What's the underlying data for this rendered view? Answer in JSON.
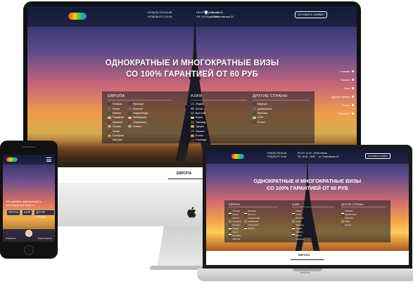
{
  "site": {
    "phones": [
      "+375(29) 370-64-56",
      "+375(29) 677-13-34"
    ],
    "hours": [
      "ПН-ПТ: 10:00 - 19:00",
      "СБ: 10:00 - 16:00"
    ],
    "address": [
      "г. Минск",
      "ул. Ульяновская 31"
    ],
    "cta_label": "ОСТАВИТЬ ЗАЯВКУ",
    "headline_line1": "ОДНОКРАТНЫЕ И МНОГОКРАТНЫЕ ВИЗЫ",
    "headline_line2": "СО 100% ГАРАНТИЕЙ ОТ 60 РУБ",
    "columns": {
      "europe": {
        "title": "ЕВРОПА",
        "left": [
          "Польша",
          "Литва",
          "Италия",
          "Германия",
          "Испания",
          "Греция",
          "Чехия",
          "Болгария",
          "Австрия"
        ],
        "right": [
          "Франция",
          "Бельгия",
          "Нидерланды",
          "Швейцария",
          "Португалия",
          "Латвия"
        ]
      },
      "asia": {
        "title": "АЗИЯ",
        "items": [
          "Индия",
          "Китай",
          "Вьетнам",
          "Корея",
          "Таиланд",
          "Турция",
          "Япония",
          "Египет",
          "Сингапур"
        ]
      },
      "other": {
        "title": "ДРУГИЕ СТРАНЫ",
        "items": [
          "Марокко",
          "Доминикана",
          "Мексика",
          "ЮАР",
          "Египет"
        ]
      }
    },
    "side_nav": [
      "Главная",
      "Европа",
      "Азия",
      "Другие страны",
      "Услуги",
      "Контакты"
    ],
    "tab_label": "ЕВРОПА",
    "flag_colors": [
      "#e2283a",
      "#ffffff",
      "#1f3d99",
      "#ffd200",
      "#0a8f3c",
      "#000000"
    ]
  },
  "phone": {
    "text_line1": "Мы делаем однократные и",
    "text_line2": "многократные визы в...",
    "buttons": [
      "ЕВРОПА",
      "АЗИЯ",
      "ДРУГИЕ СТРАНЫ"
    ],
    "bottom_left": "Позвонить",
    "bottom_right": "Задать вопрос"
  },
  "laptop": {
    "brand": "MacBook"
  }
}
